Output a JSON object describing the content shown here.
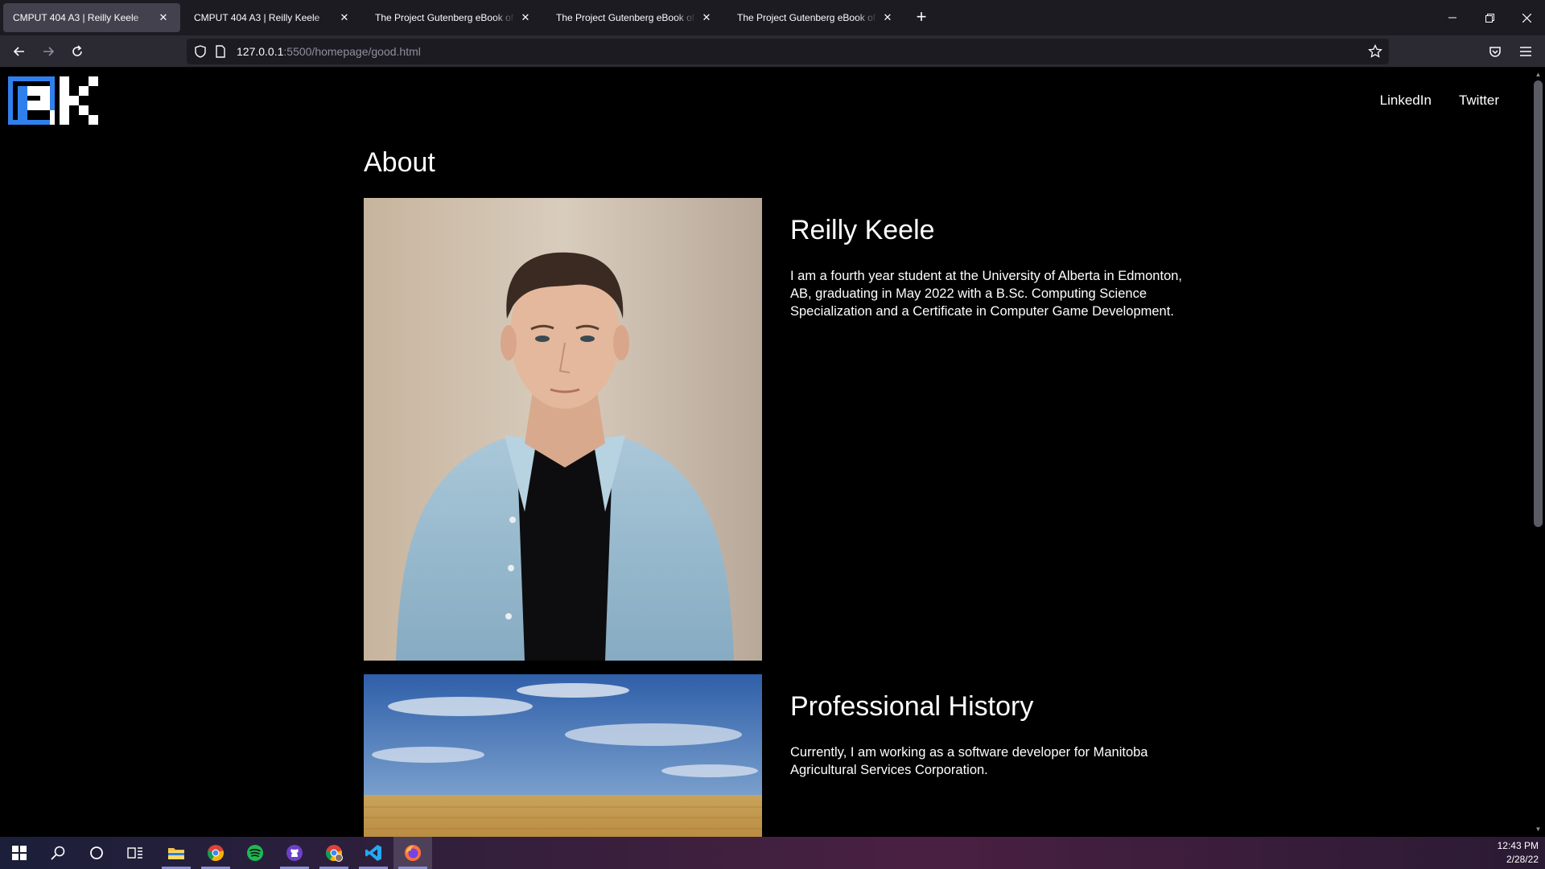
{
  "browser": {
    "tabs": [
      {
        "title": "CMPUT 404 A3 | Reilly Keele",
        "active": true
      },
      {
        "title": "CMPUT 404 A3 | Reilly Keele",
        "active": false
      },
      {
        "title": "The Project Gutenberg eBook of Heart",
        "active": false
      },
      {
        "title": "The Project Gutenberg eBook of The",
        "active": false
      },
      {
        "title": "The Project Gutenberg eBook of The",
        "active": false
      }
    ],
    "url_host": "127.0.0.1",
    "url_rest": ":5500/homepage/good.html"
  },
  "site": {
    "nav": {
      "linkedin": "LinkedIn",
      "twitter": "Twitter"
    },
    "about_heading": "About",
    "name_heading": "Reilly Keele",
    "bio": "I am a fourth year student at the University of Alberta in Edmonton, AB, graduating in May 2022 with a B.Sc. Computing Science Specialization and a Certificate in Computer Game Development.",
    "professional_heading": "Professional History",
    "professional_text": "Currently, I am working as a software developer for Manitoba Agricultural Services Corporation.",
    "colors": {
      "logo_blue": "#2f80ed",
      "background": "#000000",
      "text": "#ffffff"
    }
  },
  "taskbar": {
    "apps": [
      "windows-start",
      "search",
      "cortana",
      "task-view",
      "file-explorer",
      "chrome",
      "spotify",
      "github-desktop",
      "chrome-profile",
      "vscode",
      "firefox"
    ],
    "time": "12:43 PM",
    "date": "2/28/22"
  }
}
